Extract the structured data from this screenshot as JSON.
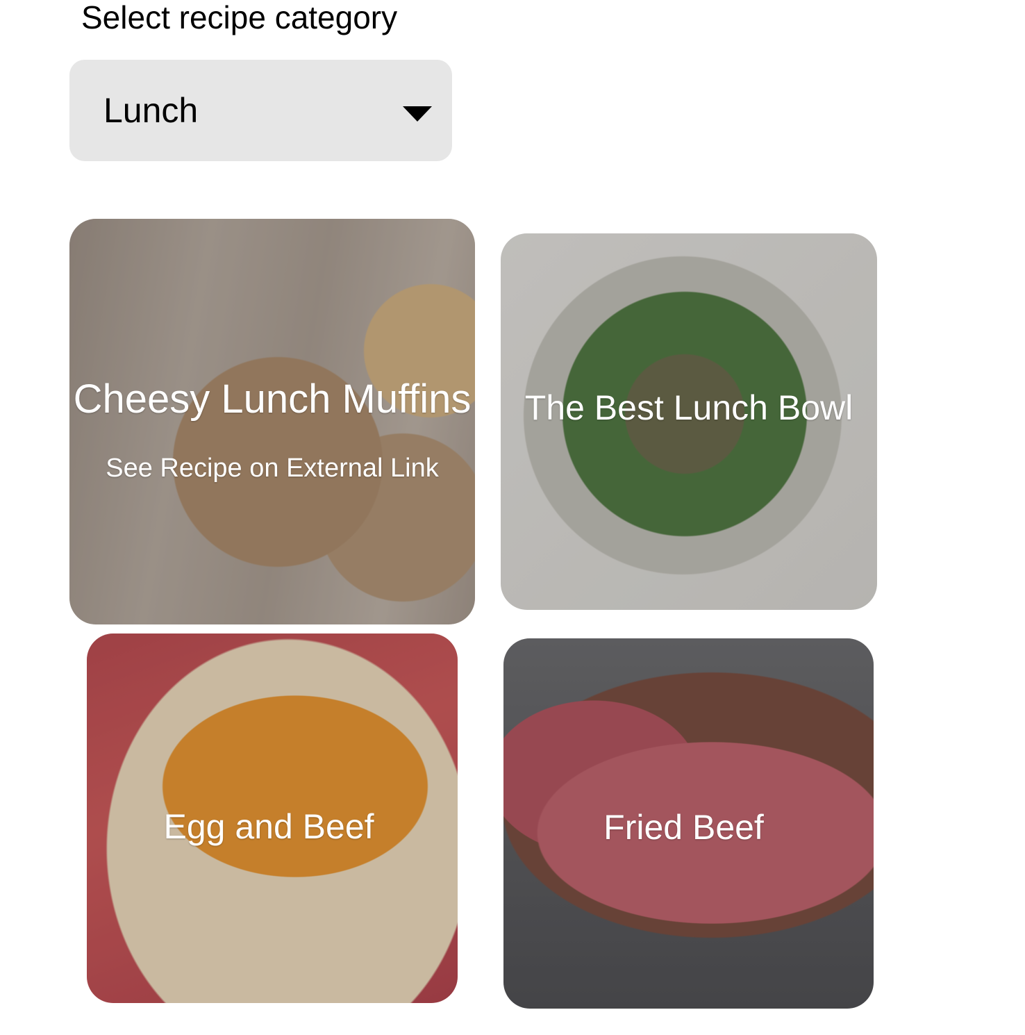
{
  "category_selector": {
    "label": "Select recipe category",
    "selected_value": "Lunch",
    "caret_icon": "caret-down-icon"
  },
  "recipes": [
    {
      "title": "Cheesy Lunch Muffins",
      "link_label": "See Recipe on External Link",
      "image": "cheese-muffins-photo"
    },
    {
      "title": "The Best Lunch Bowl",
      "image": "salad-bowl-photo"
    },
    {
      "title": "Egg and Beef",
      "image": "egg-and-beef-photo"
    },
    {
      "title": "Fried Beef",
      "image": "steak-photo"
    }
  ],
  "colors": {
    "select_background": "#e6e6e6",
    "overlay_text": "#ffffff",
    "page_background": "#ffffff"
  }
}
